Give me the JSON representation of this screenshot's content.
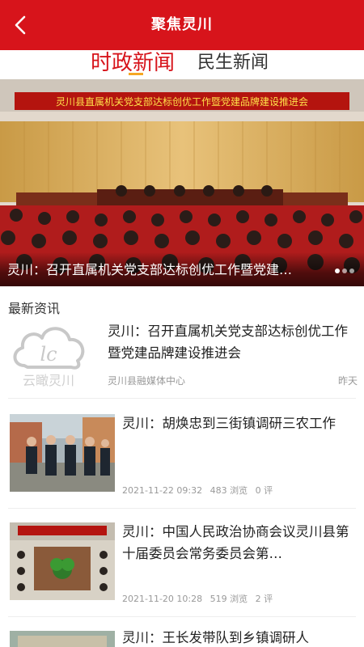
{
  "header": {
    "title": "聚焦灵川",
    "back_icon": "chevron-left-icon"
  },
  "tabs": [
    {
      "label": "时政新闻",
      "active": true
    },
    {
      "label": "民生新闻",
      "active": false
    }
  ],
  "banner": {
    "caption": "灵川：召开直属机关党支部达标创优工作暨党建品牌建设推进会",
    "backdrop_text": "灵川县直属机关党支部达标创优工作暨党建品牌建设推进会",
    "dots": 3,
    "active_dot": 0
  },
  "section_title": "最新资讯",
  "news": [
    {
      "title": "灵川：召开直属机关党支部达标创优工作暨党建品牌建设推进会",
      "source": "灵川县融媒体中心",
      "time": "昨天",
      "logo_text": "lc",
      "logo_caption": "云瞰灵川"
    },
    {
      "title": "灵川：胡焕忠到三街镇调研三农工作",
      "date": "2021-11-22 09:32",
      "views": "483 浏览",
      "comments": "0 评"
    },
    {
      "title": "灵川：中国人民政治协商会议灵川县第十届委员会常务委员会第…",
      "date": "2021-11-20 10:28",
      "views": "519 浏览",
      "comments": "2 评"
    },
    {
      "title": "灵川：王长发带队到乡镇调研人"
    }
  ],
  "colors": {
    "brand_red": "#d7141b",
    "tab_underline": "#f5a623"
  }
}
